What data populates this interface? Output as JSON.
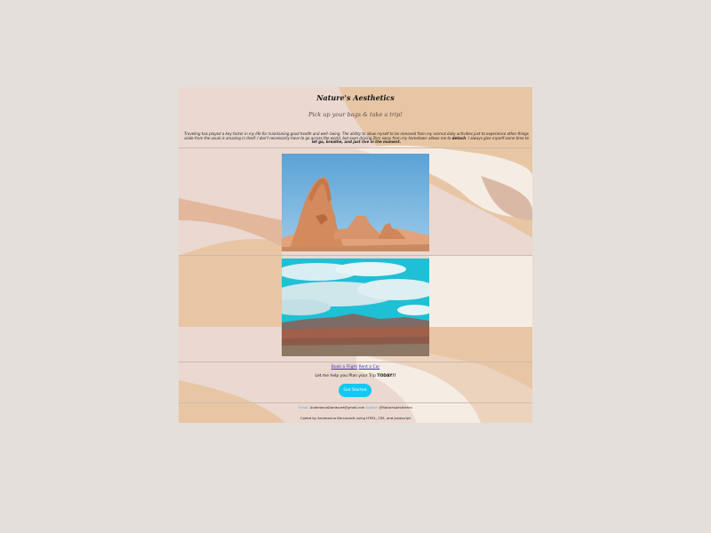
{
  "page": {
    "title": "Nature's Aesthetics",
    "subtitle": "Pick up your bags & take a trip!",
    "intro": {
      "text": "Traveling has played a key factor in my life for maintaining good health and well- being. The ability to allow myself to be removed from my normal daily activities just to experience other things aside from the usual is amazing in itself. I don't necessarily have to go across the world, but even driving 2hrs away from my hometown allows me to",
      "bold1": "detach",
      "middle": ". I always give myself some time to",
      "bold2": "let go, breathe, and just live in the moment."
    }
  },
  "photos": [
    {
      "name": "Desert arch rock formation under blue sky"
    },
    {
      "name": "Canyon landscape with cloudy turquoise sky"
    }
  ],
  "links": {
    "book_flight": "Book a Flight",
    "rent_car": "Rent a Car"
  },
  "tagline": {
    "text": "Let me help you Plan your Trip",
    "bold": "TODAY!!"
  },
  "cta": {
    "label": "Get Started"
  },
  "contact": {
    "email_label": "Email:",
    "email": "AndreannaDarrasnet@gmail.com",
    "twitter_label": "Twitter:",
    "twitter": "@NaturesAesthetics"
  },
  "footer": {
    "credit": "Coded by Andreanna Darrasnett using HTML, CSS, and Javascript"
  },
  "colors": {
    "background": "#e5dfdb",
    "card": "#ead8d1",
    "tan": "#e8c6a4",
    "cream": "#f5ede4",
    "accent_button": "#12c9ef",
    "link": "#3a2fbf"
  }
}
